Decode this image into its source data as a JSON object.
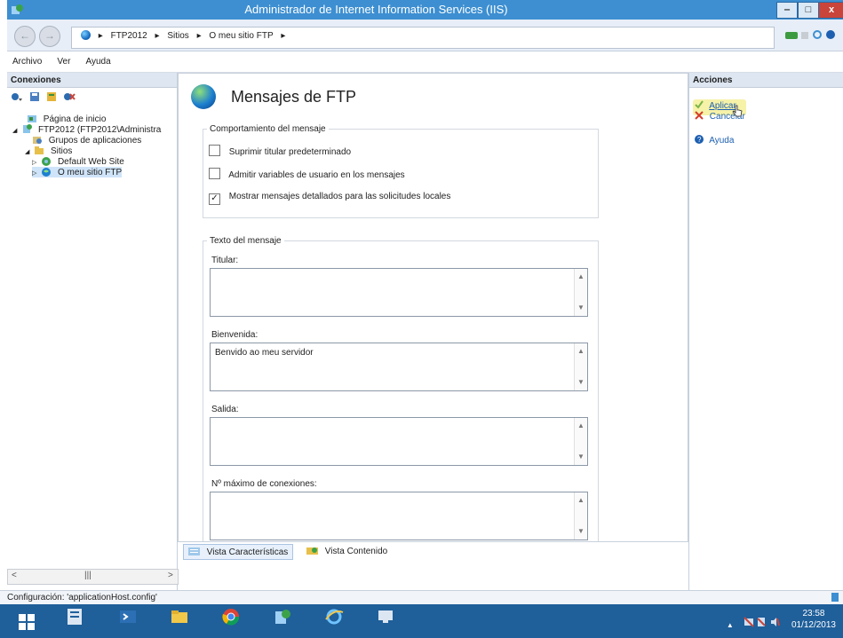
{
  "window": {
    "title": "Administrador de Internet Information Services (IIS)",
    "min_label": "‒",
    "max_label": "□",
    "close_label": "x"
  },
  "address": {
    "back_label": "←",
    "forward_label": "→",
    "breadcrumbs": [
      "FTP2012",
      "Sitios",
      "O meu sitio FTP"
    ],
    "separator": "▸"
  },
  "menu": {
    "items": [
      "Archivo",
      "Ver",
      "Ayuda"
    ]
  },
  "connections": {
    "header": "Conexiones",
    "tree": [
      {
        "label": "Página de inicio",
        "expander": "",
        "icon": "home-page-icon"
      },
      {
        "label": "FTP2012 (FTP2012\\Administra",
        "expander": "◢",
        "icon": "server-icon"
      },
      {
        "label": "Grupos de aplicaciones",
        "expander": "",
        "icon": "app-pools-icon"
      },
      {
        "label": "Sitios",
        "expander": "◢",
        "icon": "folder-icon"
      },
      {
        "label": "Default Web Site",
        "expander": "▷",
        "icon": "website-icon"
      },
      {
        "label": "O meu sitio FTP",
        "expander": "▷",
        "icon": "globe-icon"
      }
    ],
    "hscroll": {
      "left": "<",
      "thumb": "|||",
      "right": ">"
    }
  },
  "main": {
    "title": "Mensajes de FTP",
    "behavior_legend": "Comportamiento del mensaje",
    "checkboxes": [
      {
        "label": "Suprimir titular predeterminado",
        "checked": false,
        "mark": ""
      },
      {
        "label": "Admitir variables de usuario en los mensajes",
        "checked": false,
        "mark": ""
      },
      {
        "label": "Mostrar mensajes detallados para las solicitudes locales",
        "checked": true,
        "mark": "✓"
      }
    ],
    "text_legend": "Texto del mensaje",
    "fields": [
      {
        "label": "Titular:",
        "value": ""
      },
      {
        "label": "Bienvenida:",
        "value": "Benvido ao meu servidor"
      },
      {
        "label": "Salida:",
        "value": ""
      },
      {
        "label": "Nº máximo de conexiones:",
        "value": ""
      }
    ]
  },
  "views": {
    "features": "Vista Características",
    "content": "Vista Contenido"
  },
  "actions": {
    "header": "Acciones",
    "items": [
      {
        "label": "Aplicar",
        "icon": "apply-icon",
        "icon_color": "#7ab648"
      },
      {
        "label": "Cancelar",
        "icon": "cancel-icon",
        "icon_color": "#d33b2c"
      },
      {
        "label": "Ayuda",
        "icon": "help-icon",
        "icon_color": "#1d5fb0"
      }
    ]
  },
  "status": {
    "text": "Configuración: 'applicationHost.config'"
  },
  "taskbar": {
    "clock_time": "23:58",
    "clock_date": "01/12/2013",
    "tray_arrow": "▲",
    "apps": [
      "server-manager-icon",
      "powershell-icon",
      "file-explorer-icon",
      "chrome-icon",
      "iis-manager-icon",
      "internet-explorer-icon",
      "remote-desktop-icon"
    ]
  },
  "colors": {
    "title_bar": "#3d8fd1",
    "taskbar": "#1f5f9a",
    "close_button": "#c9443a",
    "selection": "#cfe4f8",
    "link": "#1d5fb0"
  }
}
